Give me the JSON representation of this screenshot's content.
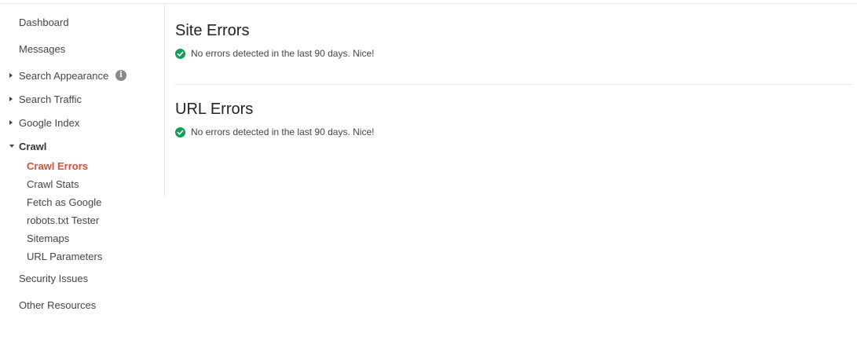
{
  "sidebar": {
    "items": [
      {
        "label": "Dashboard"
      },
      {
        "label": "Messages"
      },
      {
        "label": "Search Appearance"
      },
      {
        "label": "Search Traffic"
      },
      {
        "label": "Google Index"
      },
      {
        "label": "Crawl"
      },
      {
        "label": "Security Issues"
      },
      {
        "label": "Other Resources"
      }
    ],
    "crawl_subitems": [
      {
        "label": "Crawl Errors",
        "active": true
      },
      {
        "label": "Crawl Stats"
      },
      {
        "label": "Fetch as Google"
      },
      {
        "label": "robots.txt Tester"
      },
      {
        "label": "Sitemaps"
      },
      {
        "label": "URL Parameters"
      }
    ],
    "info_icon": "info-icon"
  },
  "main": {
    "sections": [
      {
        "title": "Site Errors",
        "status": "No errors detected in the last 90 days. Nice!",
        "status_icon": "check-circle-icon"
      },
      {
        "title": "URL Errors",
        "status": "No errors detected in the last 90 days. Nice!",
        "status_icon": "check-circle-icon"
      }
    ]
  },
  "colors": {
    "active_nav": "#dd4b39",
    "success_check": "#0f9d58",
    "divider": "#e5e5e5"
  }
}
